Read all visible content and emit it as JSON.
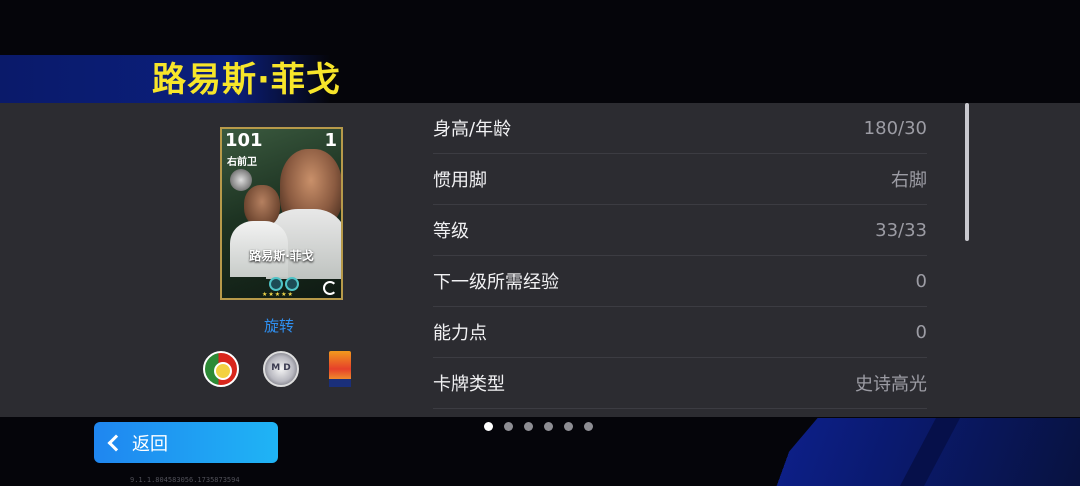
{
  "player": {
    "name": "路易斯·菲戈"
  },
  "card": {
    "rating": "101",
    "level": "1",
    "position": "右前卫",
    "name": "路易斯·菲戈",
    "stars": "★★★★★"
  },
  "actions": {
    "rotate_label": "旋转",
    "back_label": "返回"
  },
  "stats": [
    {
      "label": "身高/年龄",
      "value": "180/30"
    },
    {
      "label": "惯用脚",
      "value": "右脚"
    },
    {
      "label": "等级",
      "value": "33/33"
    },
    {
      "label": "下一级所需经验",
      "value": "0"
    },
    {
      "label": "能力点",
      "value": "0"
    },
    {
      "label": "卡牌类型",
      "value": "史诗高光"
    }
  ],
  "pagination": {
    "total_pages": 6,
    "current_page": 1
  },
  "build_text": "9.1.1.804583056.1735873594",
  "colors": {
    "title": "#f7e52a",
    "accent_link": "#2f8ff0",
    "back_button": "#1f86f0",
    "panel_bg": "#2c2c31"
  }
}
